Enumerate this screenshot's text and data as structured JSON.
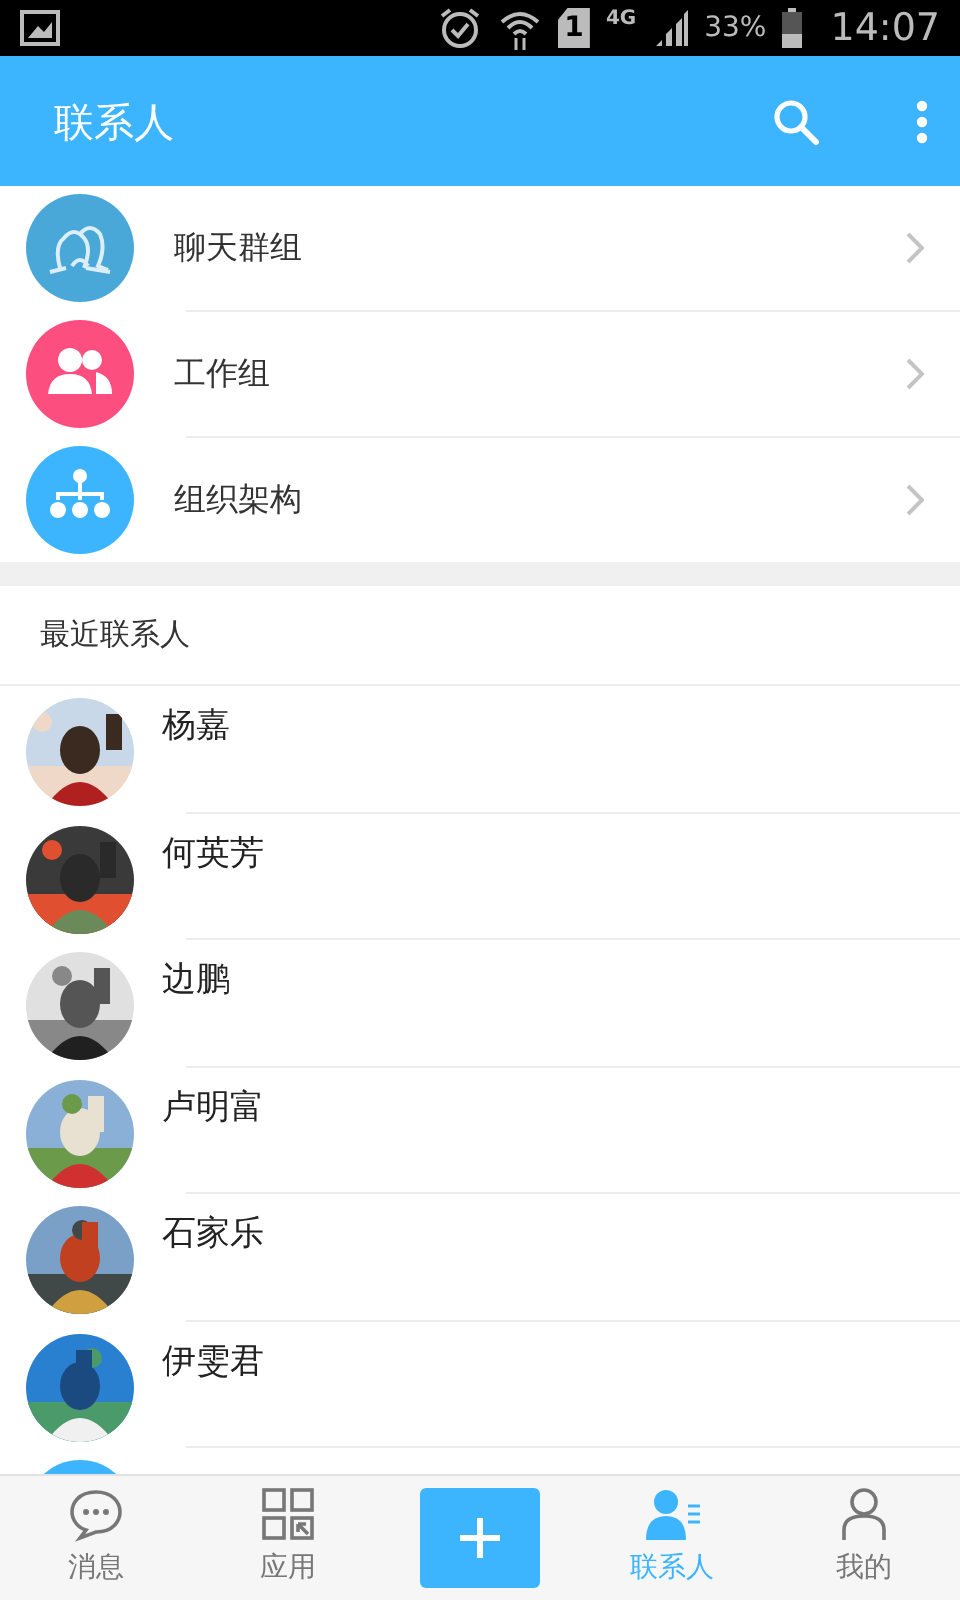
{
  "status_bar": {
    "sim": "1",
    "network": "4G",
    "battery": "33%",
    "time": "14:07"
  },
  "app_bar": {
    "title": "联系人"
  },
  "groups": [
    {
      "label": "聊天群组",
      "color": "#4aa8d8"
    },
    {
      "label": "工作组",
      "color": "#fc4f80"
    },
    {
      "label": "组织架构",
      "color": "#3cb5fe"
    }
  ],
  "recent": {
    "header": "最近联系人",
    "contacts": [
      {
        "name": "杨嘉",
        "kind": "picture"
      },
      {
        "name": "何英芳",
        "kind": "picture"
      },
      {
        "name": "边鹏",
        "kind": "picture"
      },
      {
        "name": "卢明富",
        "kind": "picture"
      },
      {
        "name": "石家乐",
        "kind": "picture"
      },
      {
        "name": "伊雯君",
        "kind": "picture"
      },
      {
        "kind": "icon"
      }
    ]
  },
  "tabs": [
    {
      "kind": "tab",
      "label": "消息",
      "selected": false
    },
    {
      "kind": "tab",
      "label": "应用",
      "selected": false
    },
    {
      "kind": "add",
      "selected": false
    },
    {
      "kind": "tab",
      "label": "联系人",
      "selected": true
    },
    {
      "kind": "tab",
      "label": "我的",
      "selected": false
    }
  ]
}
